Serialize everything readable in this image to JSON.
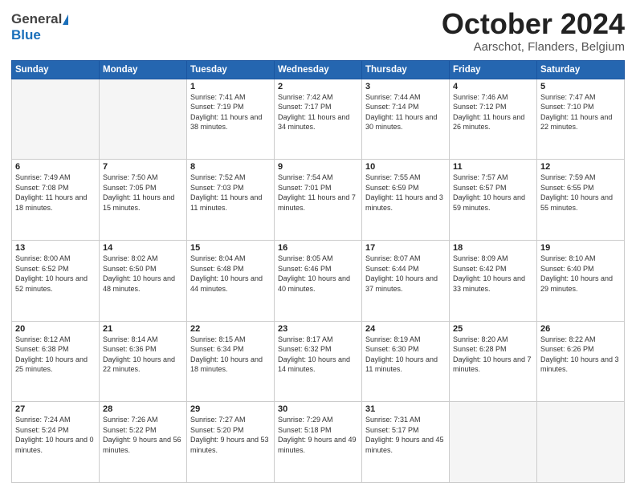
{
  "header": {
    "logo_general": "General",
    "logo_blue": "Blue",
    "month_title": "October 2024",
    "location": "Aarschot, Flanders, Belgium"
  },
  "weekdays": [
    "Sunday",
    "Monday",
    "Tuesday",
    "Wednesday",
    "Thursday",
    "Friday",
    "Saturday"
  ],
  "weeks": [
    [
      {
        "day": "",
        "sunrise": "",
        "sunset": "",
        "daylight": ""
      },
      {
        "day": "",
        "sunrise": "",
        "sunset": "",
        "daylight": ""
      },
      {
        "day": "1",
        "sunrise": "Sunrise: 7:41 AM",
        "sunset": "Sunset: 7:19 PM",
        "daylight": "Daylight: 11 hours and 38 minutes."
      },
      {
        "day": "2",
        "sunrise": "Sunrise: 7:42 AM",
        "sunset": "Sunset: 7:17 PM",
        "daylight": "Daylight: 11 hours and 34 minutes."
      },
      {
        "day": "3",
        "sunrise": "Sunrise: 7:44 AM",
        "sunset": "Sunset: 7:14 PM",
        "daylight": "Daylight: 11 hours and 30 minutes."
      },
      {
        "day": "4",
        "sunrise": "Sunrise: 7:46 AM",
        "sunset": "Sunset: 7:12 PM",
        "daylight": "Daylight: 11 hours and 26 minutes."
      },
      {
        "day": "5",
        "sunrise": "Sunrise: 7:47 AM",
        "sunset": "Sunset: 7:10 PM",
        "daylight": "Daylight: 11 hours and 22 minutes."
      }
    ],
    [
      {
        "day": "6",
        "sunrise": "Sunrise: 7:49 AM",
        "sunset": "Sunset: 7:08 PM",
        "daylight": "Daylight: 11 hours and 18 minutes."
      },
      {
        "day": "7",
        "sunrise": "Sunrise: 7:50 AM",
        "sunset": "Sunset: 7:05 PM",
        "daylight": "Daylight: 11 hours and 15 minutes."
      },
      {
        "day": "8",
        "sunrise": "Sunrise: 7:52 AM",
        "sunset": "Sunset: 7:03 PM",
        "daylight": "Daylight: 11 hours and 11 minutes."
      },
      {
        "day": "9",
        "sunrise": "Sunrise: 7:54 AM",
        "sunset": "Sunset: 7:01 PM",
        "daylight": "Daylight: 11 hours and 7 minutes."
      },
      {
        "day": "10",
        "sunrise": "Sunrise: 7:55 AM",
        "sunset": "Sunset: 6:59 PM",
        "daylight": "Daylight: 11 hours and 3 minutes."
      },
      {
        "day": "11",
        "sunrise": "Sunrise: 7:57 AM",
        "sunset": "Sunset: 6:57 PM",
        "daylight": "Daylight: 10 hours and 59 minutes."
      },
      {
        "day": "12",
        "sunrise": "Sunrise: 7:59 AM",
        "sunset": "Sunset: 6:55 PM",
        "daylight": "Daylight: 10 hours and 55 minutes."
      }
    ],
    [
      {
        "day": "13",
        "sunrise": "Sunrise: 8:00 AM",
        "sunset": "Sunset: 6:52 PM",
        "daylight": "Daylight: 10 hours and 52 minutes."
      },
      {
        "day": "14",
        "sunrise": "Sunrise: 8:02 AM",
        "sunset": "Sunset: 6:50 PM",
        "daylight": "Daylight: 10 hours and 48 minutes."
      },
      {
        "day": "15",
        "sunrise": "Sunrise: 8:04 AM",
        "sunset": "Sunset: 6:48 PM",
        "daylight": "Daylight: 10 hours and 44 minutes."
      },
      {
        "day": "16",
        "sunrise": "Sunrise: 8:05 AM",
        "sunset": "Sunset: 6:46 PM",
        "daylight": "Daylight: 10 hours and 40 minutes."
      },
      {
        "day": "17",
        "sunrise": "Sunrise: 8:07 AM",
        "sunset": "Sunset: 6:44 PM",
        "daylight": "Daylight: 10 hours and 37 minutes."
      },
      {
        "day": "18",
        "sunrise": "Sunrise: 8:09 AM",
        "sunset": "Sunset: 6:42 PM",
        "daylight": "Daylight: 10 hours and 33 minutes."
      },
      {
        "day": "19",
        "sunrise": "Sunrise: 8:10 AM",
        "sunset": "Sunset: 6:40 PM",
        "daylight": "Daylight: 10 hours and 29 minutes."
      }
    ],
    [
      {
        "day": "20",
        "sunrise": "Sunrise: 8:12 AM",
        "sunset": "Sunset: 6:38 PM",
        "daylight": "Daylight: 10 hours and 25 minutes."
      },
      {
        "day": "21",
        "sunrise": "Sunrise: 8:14 AM",
        "sunset": "Sunset: 6:36 PM",
        "daylight": "Daylight: 10 hours and 22 minutes."
      },
      {
        "day": "22",
        "sunrise": "Sunrise: 8:15 AM",
        "sunset": "Sunset: 6:34 PM",
        "daylight": "Daylight: 10 hours and 18 minutes."
      },
      {
        "day": "23",
        "sunrise": "Sunrise: 8:17 AM",
        "sunset": "Sunset: 6:32 PM",
        "daylight": "Daylight: 10 hours and 14 minutes."
      },
      {
        "day": "24",
        "sunrise": "Sunrise: 8:19 AM",
        "sunset": "Sunset: 6:30 PM",
        "daylight": "Daylight: 10 hours and 11 minutes."
      },
      {
        "day": "25",
        "sunrise": "Sunrise: 8:20 AM",
        "sunset": "Sunset: 6:28 PM",
        "daylight": "Daylight: 10 hours and 7 minutes."
      },
      {
        "day": "26",
        "sunrise": "Sunrise: 8:22 AM",
        "sunset": "Sunset: 6:26 PM",
        "daylight": "Daylight: 10 hours and 3 minutes."
      }
    ],
    [
      {
        "day": "27",
        "sunrise": "Sunrise: 7:24 AM",
        "sunset": "Sunset: 5:24 PM",
        "daylight": "Daylight: 10 hours and 0 minutes."
      },
      {
        "day": "28",
        "sunrise": "Sunrise: 7:26 AM",
        "sunset": "Sunset: 5:22 PM",
        "daylight": "Daylight: 9 hours and 56 minutes."
      },
      {
        "day": "29",
        "sunrise": "Sunrise: 7:27 AM",
        "sunset": "Sunset: 5:20 PM",
        "daylight": "Daylight: 9 hours and 53 minutes."
      },
      {
        "day": "30",
        "sunrise": "Sunrise: 7:29 AM",
        "sunset": "Sunset: 5:18 PM",
        "daylight": "Daylight: 9 hours and 49 minutes."
      },
      {
        "day": "31",
        "sunrise": "Sunrise: 7:31 AM",
        "sunset": "Sunset: 5:17 PM",
        "daylight": "Daylight: 9 hours and 45 minutes."
      },
      {
        "day": "",
        "sunrise": "",
        "sunset": "",
        "daylight": ""
      },
      {
        "day": "",
        "sunrise": "",
        "sunset": "",
        "daylight": ""
      }
    ]
  ]
}
